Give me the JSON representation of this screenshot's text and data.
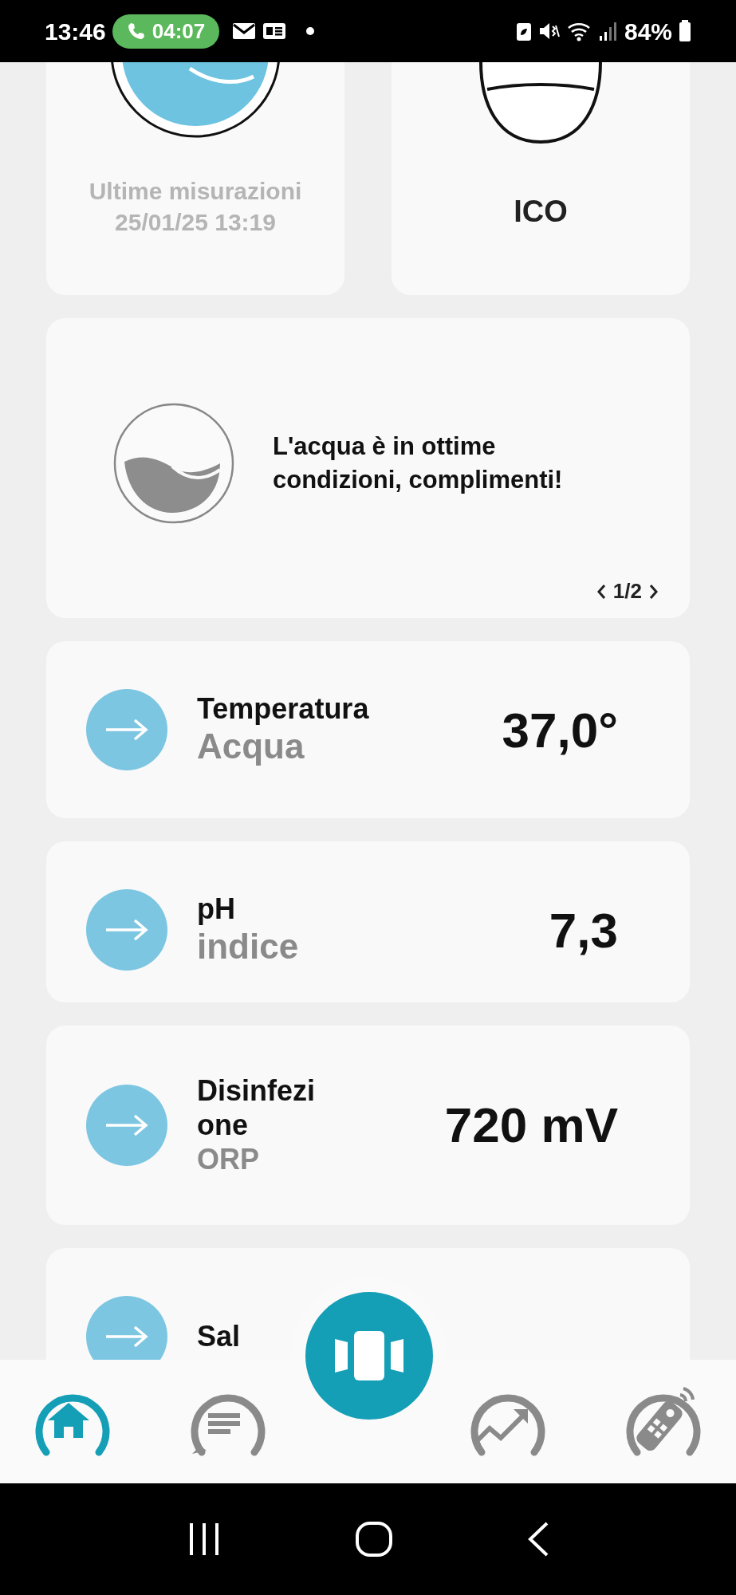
{
  "status_bar": {
    "time": "13:46",
    "call_timer": "04:07",
    "battery": "84%"
  },
  "last_measurement": {
    "label": "Ultime misurazioni",
    "datetime": "25/01/25 13:19"
  },
  "device": {
    "name": "ICO"
  },
  "message": {
    "text": "L'acqua è in ottime condizioni, complimenti!",
    "pager": "1/2"
  },
  "metrics": [
    {
      "title": "Temperatura",
      "subtitle": "Acqua",
      "value": "37,0°"
    },
    {
      "title": "pH",
      "subtitle": "indice",
      "value": "7,3"
    },
    {
      "title": "Disinfezione",
      "subtitle": "ORP",
      "value": "720 mV"
    },
    {
      "title": "Sal"
    }
  ],
  "bottom_nav": [
    {
      "kind": "home",
      "selected": true
    },
    {
      "kind": "messages",
      "selected": false
    },
    {
      "kind": "trend",
      "selected": false
    },
    {
      "kind": "remote",
      "selected": false
    }
  ]
}
